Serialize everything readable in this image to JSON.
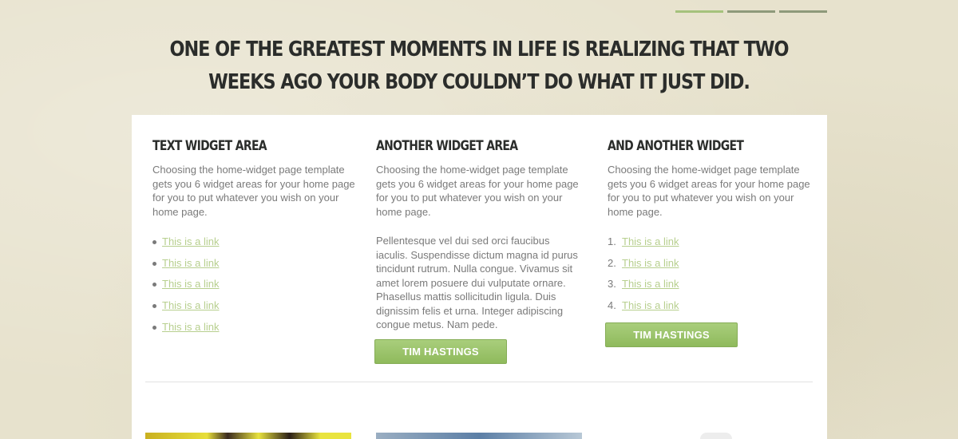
{
  "slider": {
    "dots": 3,
    "active_index": 0
  },
  "headline": "ONE OF THE GREATEST MOMENTS IN LIFE IS REALIZING THAT TWO WEEKS AGO YOUR BODY COULDN’T DO WHAT IT JUST DID.",
  "widgets": {
    "col1": {
      "title": "TEXT WIDGET AREA",
      "text": "Choosing the home-widget page template gets you 6 widget areas for your home page for you to put whatever you wish on your home page.",
      "links": [
        "This is a link",
        "This is a link",
        "This is a link",
        "This is a link",
        "This is a link"
      ]
    },
    "col2": {
      "title": "ANOTHER WIDGET AREA",
      "text": "Choosing the home-widget page template gets you 6 widget areas for your home page for you to put whatever you wish on your home page.",
      "text2": "Pellentesque vel dui sed orci faucibus iaculis. Suspendisse dictum magna id purus tincidunt rutrum. Nulla congue. Vivamus sit amet lorem posuere dui vulputate ornare. Phasellus mattis sollicitudin ligula. Duis dignissim felis et urna. Integer adipiscing congue metus. Nam pede.",
      "button": "TIM HASTINGS"
    },
    "col3": {
      "title": "AND ANOTHER WIDGET",
      "text": "Choosing the home-widget page template gets you 6 widget areas for your home page for you to put whatever you wish on your home page.",
      "links": [
        {
          "num": "1.",
          "label": "This is a link"
        },
        {
          "num": "2.",
          "label": "This is a link"
        },
        {
          "num": "3.",
          "label": "This is a link"
        },
        {
          "num": "4.",
          "label": "This is a link"
        }
      ],
      "button": "TIM HASTINGS"
    }
  },
  "colors": {
    "accent_green": "#a5c27c",
    "link_green": "#b7cf8e",
    "heading": "#2b2d2b",
    "body_text": "#7a7a7a"
  }
}
